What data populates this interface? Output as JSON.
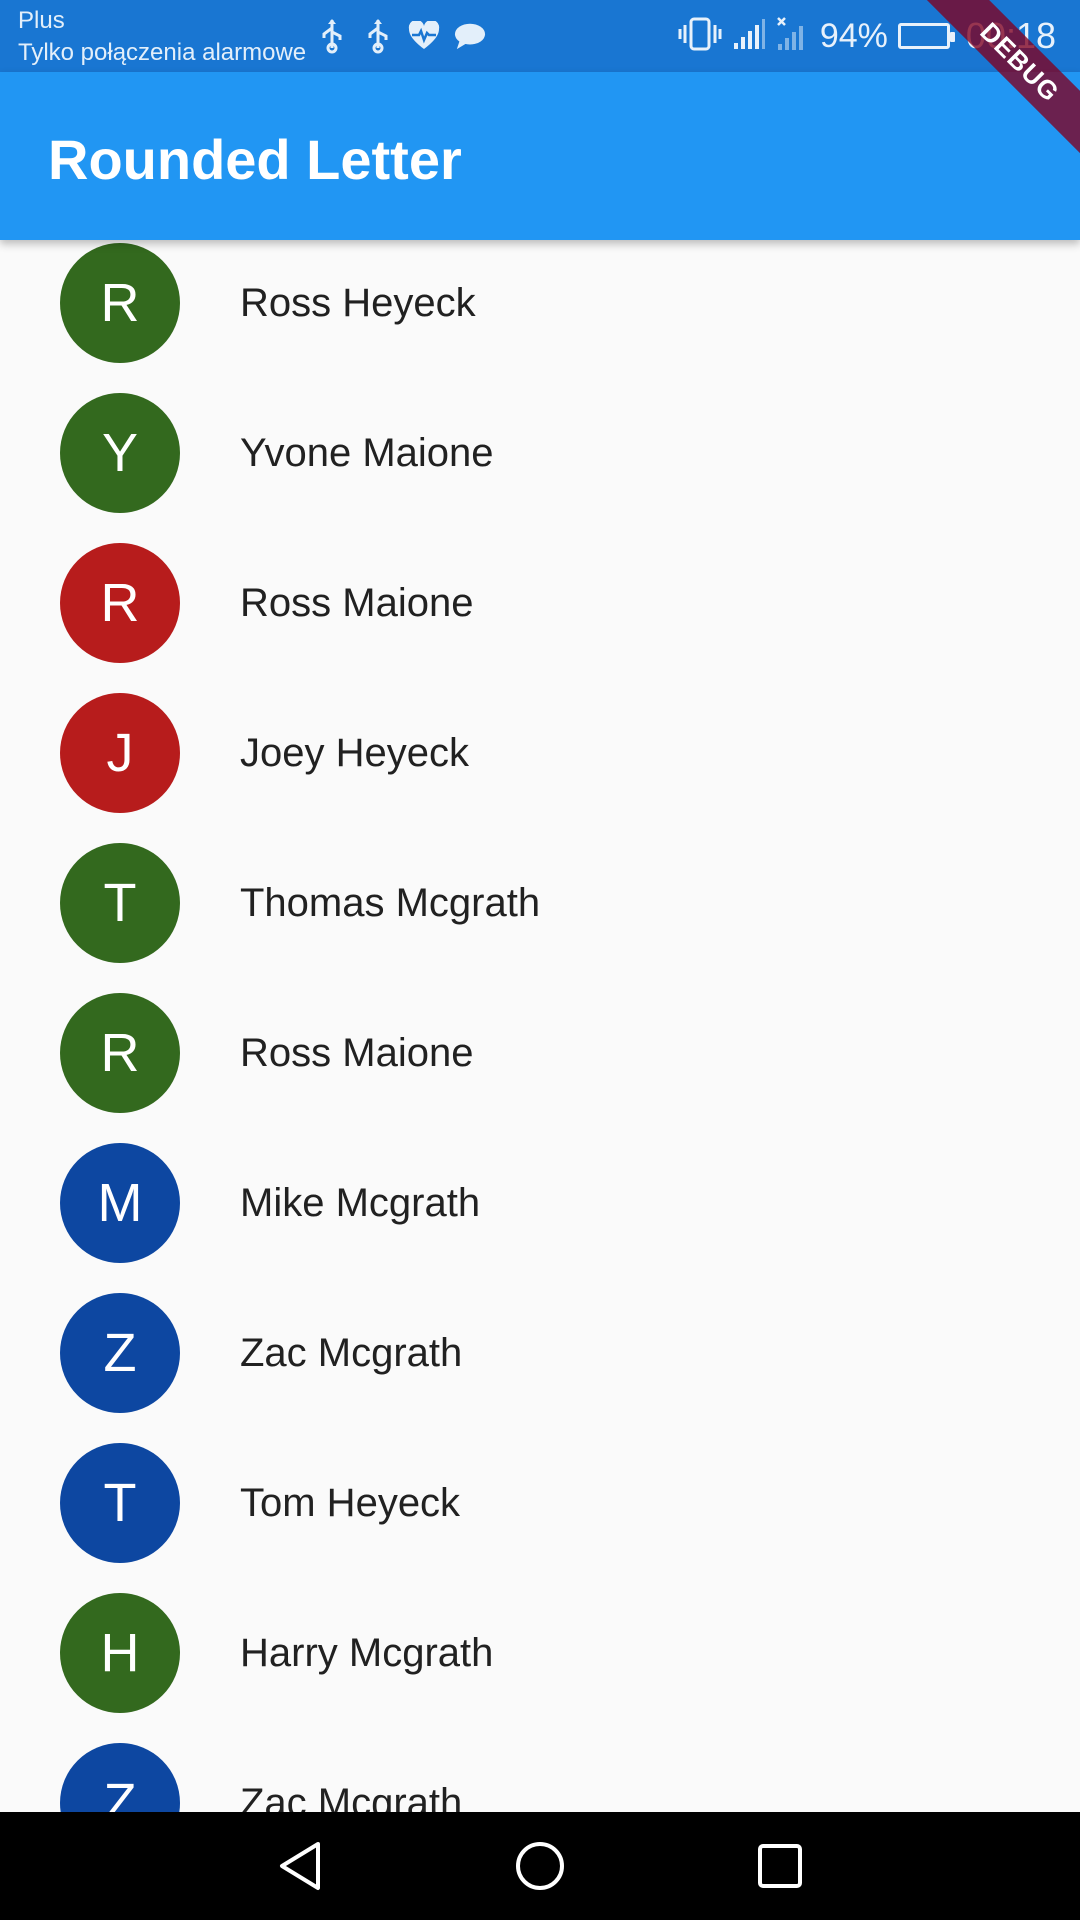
{
  "status_bar": {
    "carrier": "Plus",
    "carrier_status": "Tylko połączenia alarmowe",
    "notification_icons": [
      "usb-icon",
      "usb-icon",
      "heart-pulse-icon",
      "chat-bubble-icon"
    ],
    "battery_percent": "94%",
    "battery_level": 0.94,
    "time": "00:18"
  },
  "app_bar": {
    "title": "Rounded Letter",
    "color": "#2196f3"
  },
  "debug_banner": "DEBUG",
  "contacts": [
    {
      "letter": "R",
      "name": "Ross Heyeck",
      "color": "#33691e"
    },
    {
      "letter": "Y",
      "name": "Yvone Maione",
      "color": "#33691e"
    },
    {
      "letter": "R",
      "name": "Ross Maione",
      "color": "#b71c1c"
    },
    {
      "letter": "J",
      "name": "Joey Heyeck",
      "color": "#b71c1c"
    },
    {
      "letter": "T",
      "name": "Thomas Mcgrath",
      "color": "#33691e"
    },
    {
      "letter": "R",
      "name": "Ross Maione",
      "color": "#33691e"
    },
    {
      "letter": "M",
      "name": "Mike Mcgrath",
      "color": "#0d47a1"
    },
    {
      "letter": "Z",
      "name": "Zac Mcgrath",
      "color": "#0d47a1"
    },
    {
      "letter": "T",
      "name": "Tom Heyeck",
      "color": "#0d47a1"
    },
    {
      "letter": "H",
      "name": "Harry Mcgrath",
      "color": "#33691e"
    },
    {
      "letter": "Z",
      "name": "Zac Mcgrath",
      "color": "#0d47a1"
    }
  ],
  "nav_bar": {
    "buttons": [
      "back-icon",
      "home-icon",
      "recents-icon"
    ]
  }
}
